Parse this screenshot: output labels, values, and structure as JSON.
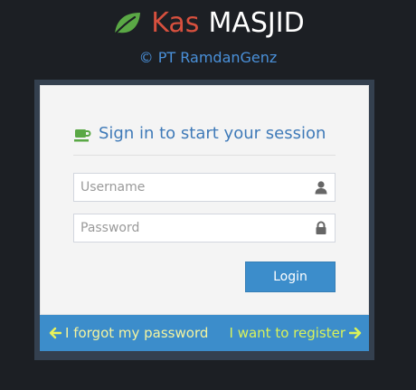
{
  "brand": {
    "icon": "leaf-icon",
    "name_part1": "Kas",
    "name_part2": "MASJID",
    "copyright": "© PT RamdanGenz",
    "colors": {
      "part1": "#d7503e",
      "part2": "#ffffff",
      "leaf": "#5aa845"
    }
  },
  "login": {
    "heading_icon": "coffee-cup-icon",
    "heading": "Sign in to start your session",
    "username_placeholder": "Username",
    "username_icon": "user-icon",
    "password_placeholder": "Password",
    "password_icon": "lock-icon",
    "submit_label": "Login"
  },
  "footer": {
    "forgot_label": "I forgot my password",
    "forgot_icon": "arrow-left-icon",
    "register_label": "I want to register",
    "register_icon": "arrow-right-icon"
  },
  "colors": {
    "background": "#1c1f24",
    "accent": "#3c8dcb",
    "heading": "#3f7ab8",
    "link": "#d9f25a"
  }
}
